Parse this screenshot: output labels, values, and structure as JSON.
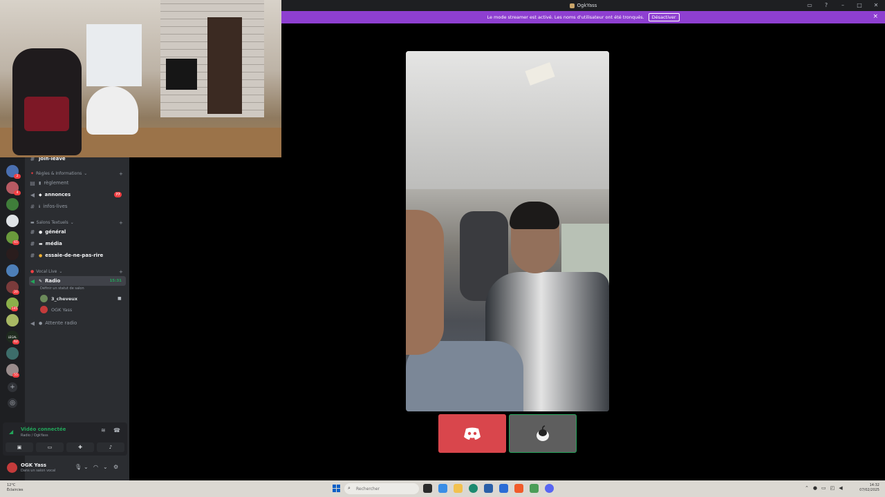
{
  "window": {
    "title": "OgkYass"
  },
  "banner": {
    "message": "Le mode streamer est activé. Les noms d'utilisateur ont été tronqués.",
    "button": "Désactiver",
    "close": "×"
  },
  "servers": {
    "badges": [
      "2",
      "4",
      "65",
      "20",
      "145",
      "62",
      "55"
    ],
    "label_legal": "LEGAL"
  },
  "channels": {
    "top_partial": "join-leave",
    "categories": [
      {
        "label": "Règles & Informations"
      },
      {
        "label": "Salons Textuels"
      },
      {
        "label": "Vocal Live"
      }
    ],
    "items": [
      {
        "name": "règlement"
      },
      {
        "name": "annonces",
        "mention": "77"
      },
      {
        "name": "infos-lives"
      },
      {
        "name": "général"
      },
      {
        "name": "média"
      },
      {
        "name": "essaie-de-ne-pas-rire"
      },
      {
        "name": "Radio",
        "timer": "15:31"
      },
      {
        "name": "Attente radio"
      }
    ],
    "voice_status": "Définir un statut de salon",
    "voice_users": [
      {
        "name": "3_cheveux"
      },
      {
        "name": "OGK Yass"
      }
    ]
  },
  "voice_panel": {
    "state": "Vidéo connectée",
    "location": "Radio / OgkYass"
  },
  "user": {
    "name": "OGK Yass",
    "status": "Dans un salon vocal"
  },
  "taskbar": {
    "temperature": "12°C",
    "weather": "Éclaircies",
    "search_placeholder": "Rechercher",
    "time": "14:32",
    "date": "07/02/2025"
  },
  "colors": {
    "banner": "#8e3fd1",
    "discord_tile": "#d9464c",
    "connected_green": "#23a55a",
    "mention_red": "#f23f43"
  }
}
